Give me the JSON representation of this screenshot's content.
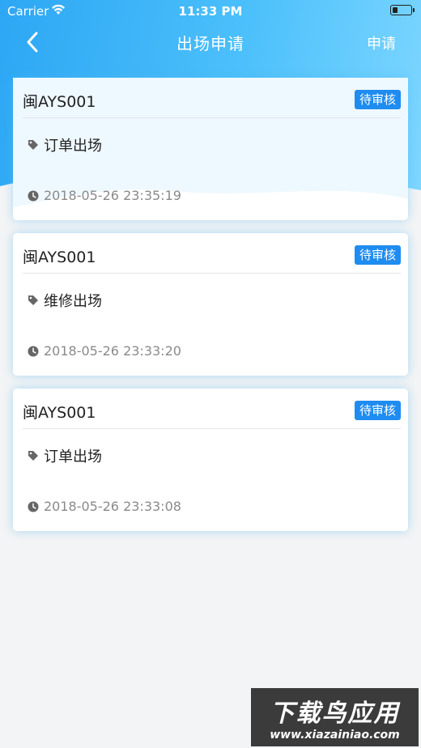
{
  "status_bar": {
    "carrier": "Carrier",
    "time": "11:33 PM"
  },
  "nav": {
    "title": "出场申请",
    "apply_label": "申请"
  },
  "records": [
    {
      "plate": "闽AYS001",
      "status": "待审核",
      "type": "订单出场",
      "time": "2018-05-26 23:35:19"
    },
    {
      "plate": "闽AYS001",
      "status": "待审核",
      "type": "维修出场",
      "time": "2018-05-26 23:33:20"
    },
    {
      "plate": "闽AYS001",
      "status": "待审核",
      "type": "订单出场",
      "time": "2018-05-26 23:33:08"
    }
  ],
  "watermark": {
    "title": "下载鸟应用",
    "url": "www.xiazainiao.com"
  },
  "colors": {
    "header": "#2da7f4",
    "badge": "#1e8cf0",
    "background": "#f3f4f5"
  }
}
